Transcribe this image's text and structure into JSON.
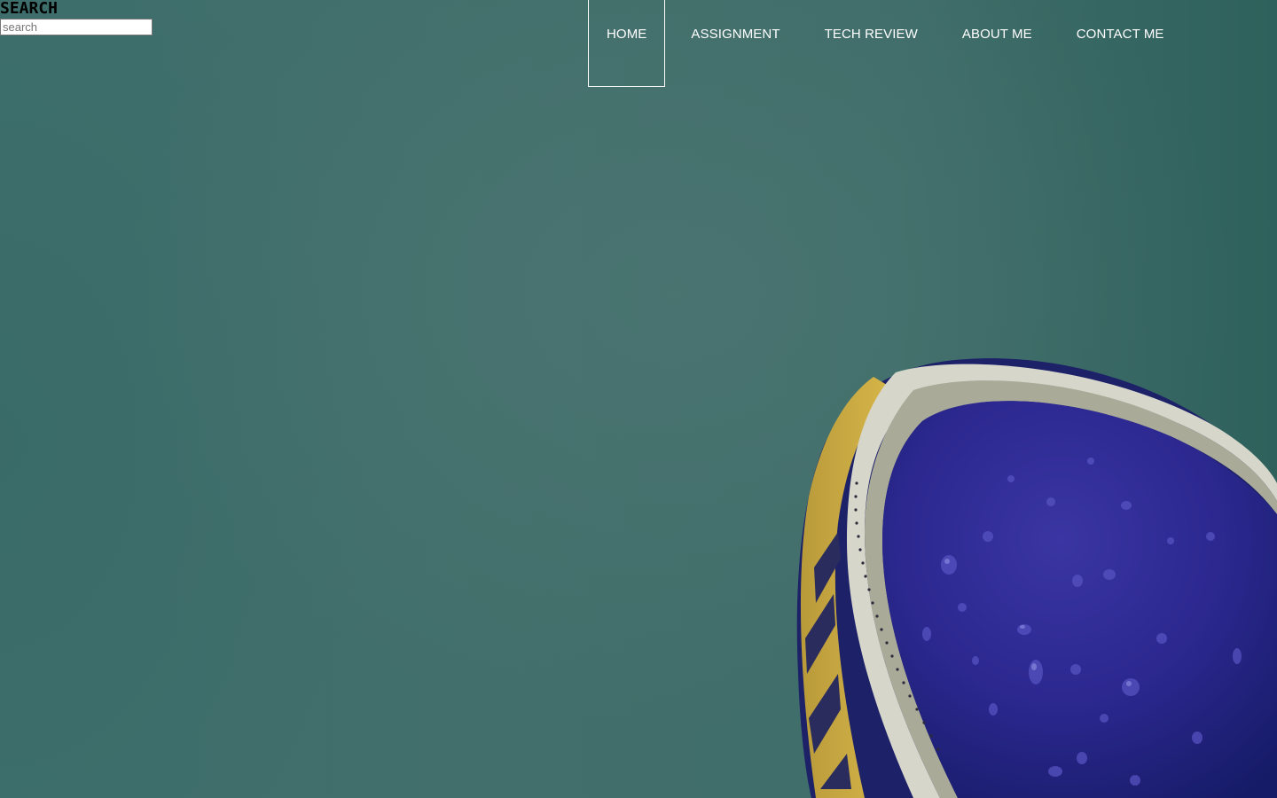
{
  "search": {
    "heading": "SEARCH",
    "placeholder": "search",
    "value": ""
  },
  "nav": {
    "items": [
      {
        "label": "HOME",
        "active": true
      },
      {
        "label": "ASSIGNMENT",
        "active": false
      },
      {
        "label": "TECH REVIEW",
        "active": false
      },
      {
        "label": "ABOUT ME",
        "active": false
      },
      {
        "label": "CONTACT ME",
        "active": false
      }
    ]
  },
  "hero": {
    "background_color": "#3f6e6a",
    "ball_colors": {
      "panel": "#2a2a8c",
      "stripe_yellow": "#c9a63a",
      "stripe_white": "#d8d8cc"
    }
  }
}
